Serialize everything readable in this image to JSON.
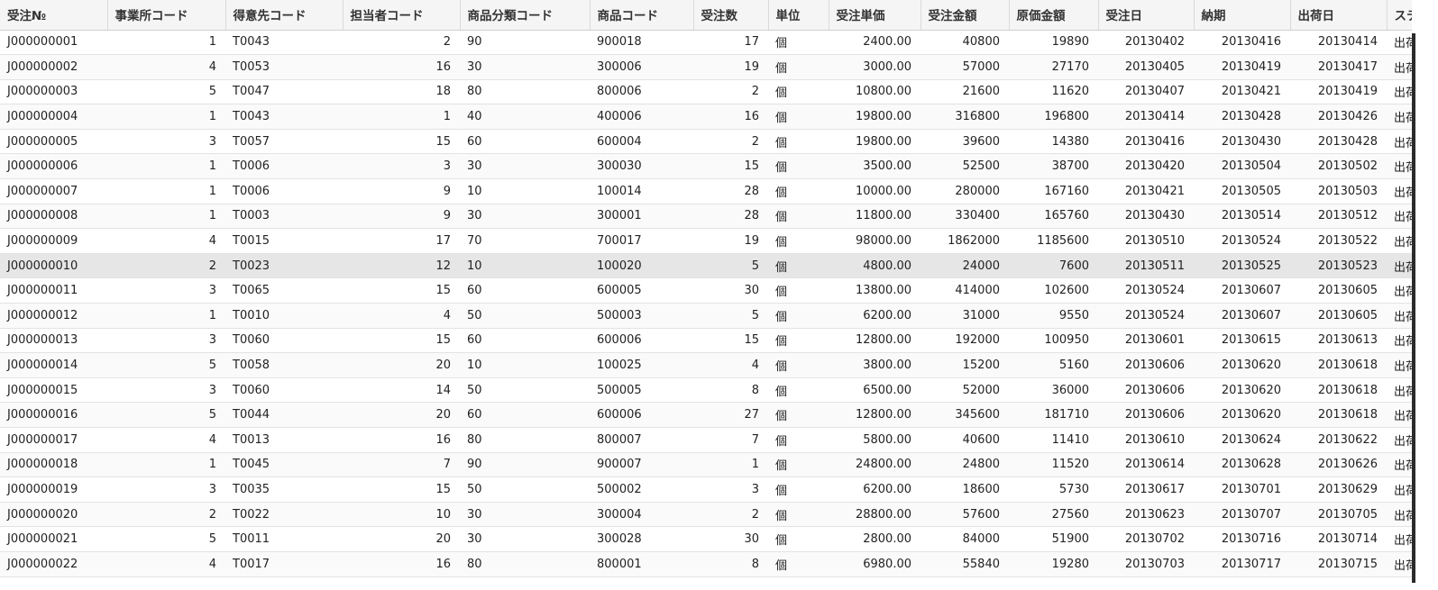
{
  "grid": {
    "columns": [
      "受注№",
      "事業所コード",
      "得意先コード",
      "担当者コード",
      "商品分類コード",
      "商品コード",
      "受注数",
      "単位",
      "受注単価",
      "受注金額",
      "原価金額",
      "受注日",
      "納期",
      "出荷日",
      "ステー"
    ],
    "selected_row": 9,
    "rows": [
      [
        "J000000001",
        "1",
        "T0043",
        "2",
        "90",
        "900018",
        "17",
        "個",
        "2400.00",
        "40800",
        "19890",
        "20130402",
        "20130416",
        "20130414",
        "出荷"
      ],
      [
        "J000000002",
        "4",
        "T0053",
        "16",
        "30",
        "300006",
        "19",
        "個",
        "3000.00",
        "57000",
        "27170",
        "20130405",
        "20130419",
        "20130417",
        "出荷"
      ],
      [
        "J000000003",
        "5",
        "T0047",
        "18",
        "80",
        "800006",
        "2",
        "個",
        "10800.00",
        "21600",
        "11620",
        "20130407",
        "20130421",
        "20130419",
        "出荷"
      ],
      [
        "J000000004",
        "1",
        "T0043",
        "1",
        "40",
        "400006",
        "16",
        "個",
        "19800.00",
        "316800",
        "196800",
        "20130414",
        "20130428",
        "20130426",
        "出荷"
      ],
      [
        "J000000005",
        "3",
        "T0057",
        "15",
        "60",
        "600004",
        "2",
        "個",
        "19800.00",
        "39600",
        "14380",
        "20130416",
        "20130430",
        "20130428",
        "出荷"
      ],
      [
        "J000000006",
        "1",
        "T0006",
        "3",
        "30",
        "300030",
        "15",
        "個",
        "3500.00",
        "52500",
        "38700",
        "20130420",
        "20130504",
        "20130502",
        "出荷"
      ],
      [
        "J000000007",
        "1",
        "T0006",
        "9",
        "10",
        "100014",
        "28",
        "個",
        "10000.00",
        "280000",
        "167160",
        "20130421",
        "20130505",
        "20130503",
        "出荷"
      ],
      [
        "J000000008",
        "1",
        "T0003",
        "9",
        "30",
        "300001",
        "28",
        "個",
        "11800.00",
        "330400",
        "165760",
        "20130430",
        "20130514",
        "20130512",
        "出荷"
      ],
      [
        "J000000009",
        "4",
        "T0015",
        "17",
        "70",
        "700017",
        "19",
        "個",
        "98000.00",
        "1862000",
        "1185600",
        "20130510",
        "20130524",
        "20130522",
        "出荷"
      ],
      [
        "J000000010",
        "2",
        "T0023",
        "12",
        "10",
        "100020",
        "5",
        "個",
        "4800.00",
        "24000",
        "7600",
        "20130511",
        "20130525",
        "20130523",
        "出荷"
      ],
      [
        "J000000011",
        "3",
        "T0065",
        "15",
        "60",
        "600005",
        "30",
        "個",
        "13800.00",
        "414000",
        "102600",
        "20130524",
        "20130607",
        "20130605",
        "出荷"
      ],
      [
        "J000000012",
        "1",
        "T0010",
        "4",
        "50",
        "500003",
        "5",
        "個",
        "6200.00",
        "31000",
        "9550",
        "20130524",
        "20130607",
        "20130605",
        "出荷"
      ],
      [
        "J000000013",
        "3",
        "T0060",
        "15",
        "60",
        "600006",
        "15",
        "個",
        "12800.00",
        "192000",
        "100950",
        "20130601",
        "20130615",
        "20130613",
        "出荷"
      ],
      [
        "J000000014",
        "5",
        "T0058",
        "20",
        "10",
        "100025",
        "4",
        "個",
        "3800.00",
        "15200",
        "5160",
        "20130606",
        "20130620",
        "20130618",
        "出荷"
      ],
      [
        "J000000015",
        "3",
        "T0060",
        "14",
        "50",
        "500005",
        "8",
        "個",
        "6500.00",
        "52000",
        "36000",
        "20130606",
        "20130620",
        "20130618",
        "出荷"
      ],
      [
        "J000000016",
        "5",
        "T0044",
        "20",
        "60",
        "600006",
        "27",
        "個",
        "12800.00",
        "345600",
        "181710",
        "20130606",
        "20130620",
        "20130618",
        "出荷"
      ],
      [
        "J000000017",
        "4",
        "T0013",
        "16",
        "80",
        "800007",
        "7",
        "個",
        "5800.00",
        "40600",
        "11410",
        "20130610",
        "20130624",
        "20130622",
        "出荷"
      ],
      [
        "J000000018",
        "1",
        "T0045",
        "7",
        "90",
        "900007",
        "1",
        "個",
        "24800.00",
        "24800",
        "11520",
        "20130614",
        "20130628",
        "20130626",
        "出荷"
      ],
      [
        "J000000019",
        "3",
        "T0035",
        "15",
        "50",
        "500002",
        "3",
        "個",
        "6200.00",
        "18600",
        "5730",
        "20130617",
        "20130701",
        "20130629",
        "出荷"
      ],
      [
        "J000000020",
        "2",
        "T0022",
        "10",
        "30",
        "300004",
        "2",
        "個",
        "28800.00",
        "57600",
        "27560",
        "20130623",
        "20130707",
        "20130705",
        "出荷"
      ],
      [
        "J000000021",
        "5",
        "T0011",
        "20",
        "30",
        "300028",
        "30",
        "個",
        "2800.00",
        "84000",
        "51900",
        "20130702",
        "20130716",
        "20130714",
        "出荷"
      ],
      [
        "J000000022",
        "4",
        "T0017",
        "16",
        "80",
        "800001",
        "8",
        "個",
        "6980.00",
        "55840",
        "19280",
        "20130703",
        "20130717",
        "20130715",
        "出荷"
      ]
    ]
  }
}
